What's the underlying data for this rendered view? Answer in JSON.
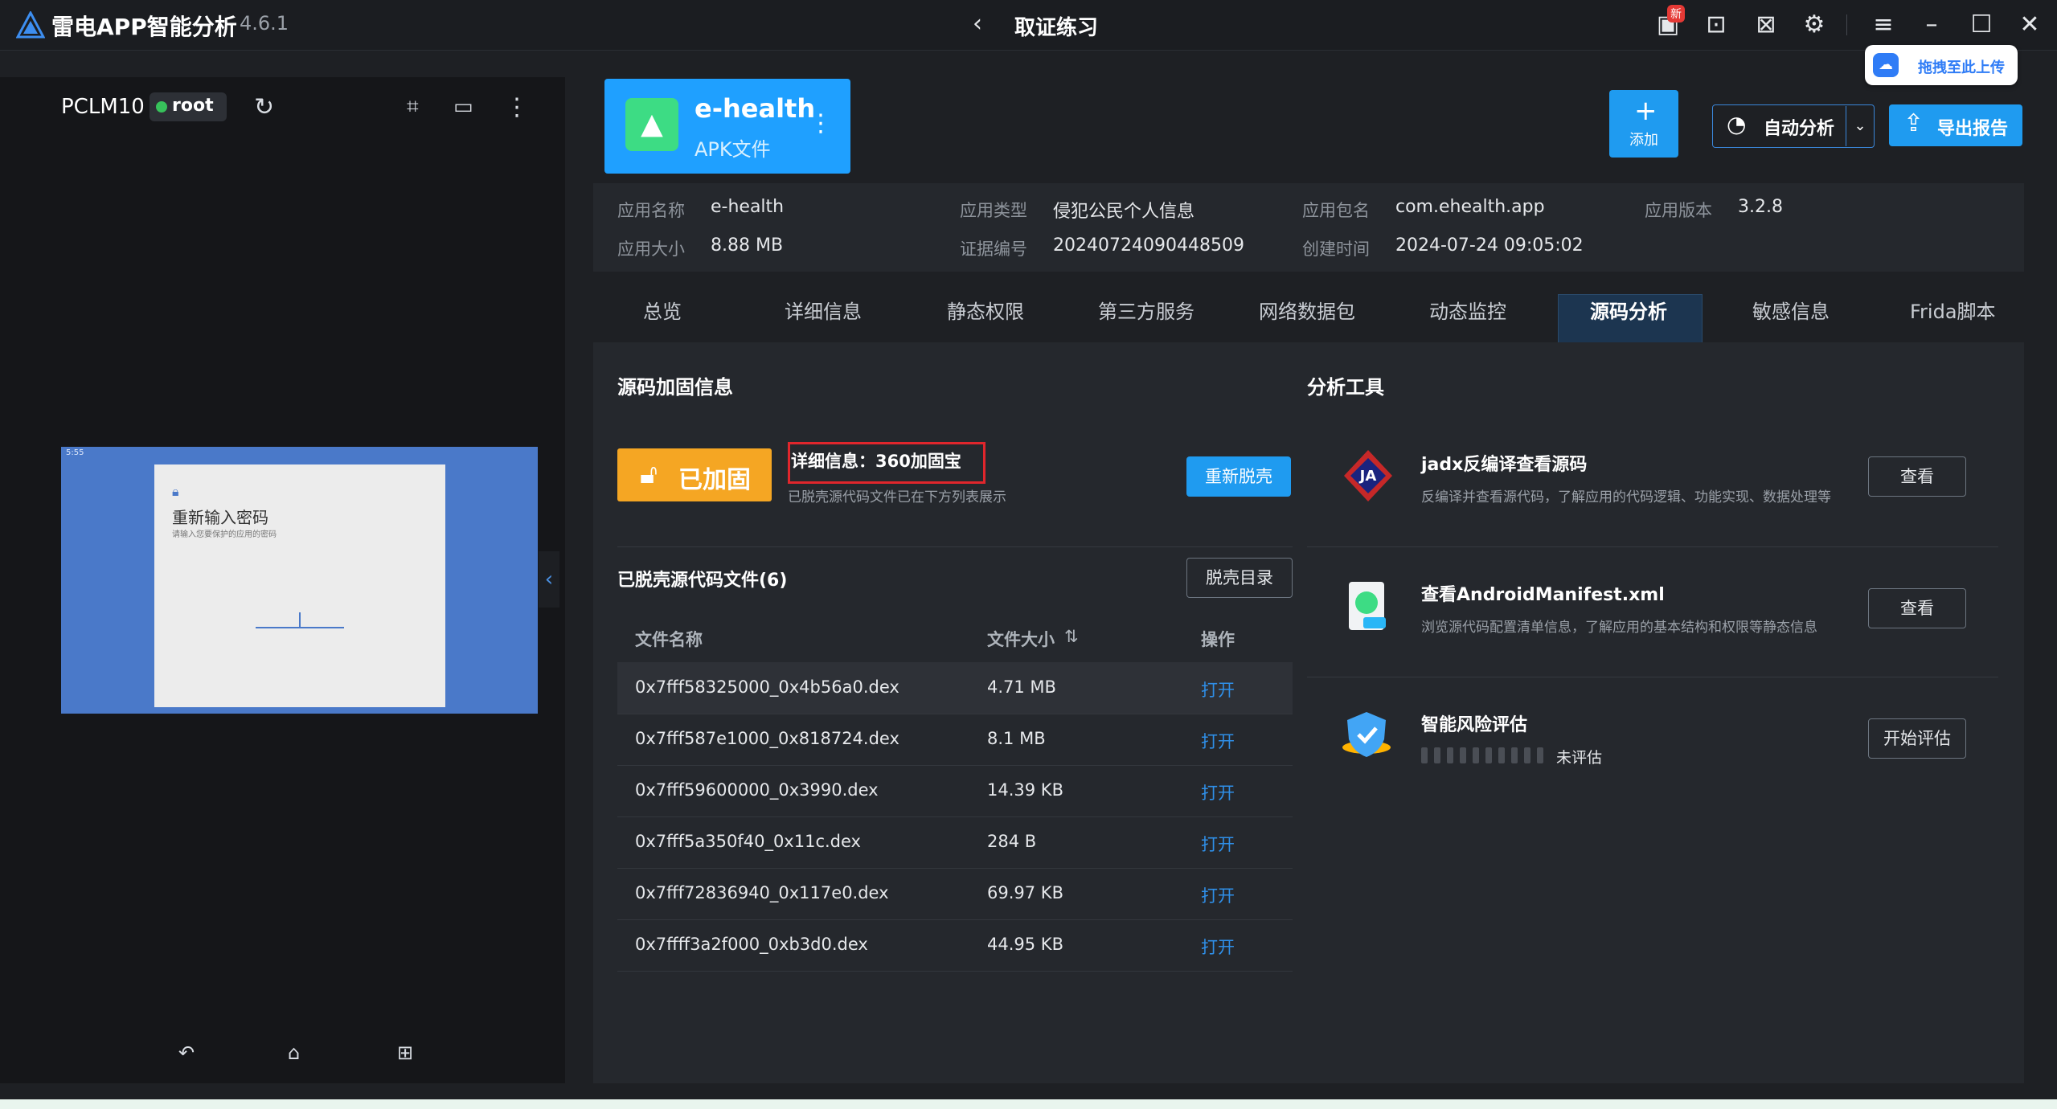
{
  "app": {
    "title": "雷电APP智能分析",
    "version": "4.6.1"
  },
  "header": {
    "page_title": "取证练习",
    "new_badge": "新",
    "upload_label": "拖拽至此上传"
  },
  "device": {
    "name": "PCLM10",
    "root_label": "root"
  },
  "screen": {
    "dialog_title": "重新输入密码",
    "dialog_sub": "请输入您要保护的应用的密码",
    "status_left": "5:55"
  },
  "app_card": {
    "name": "e-health",
    "type": "APK文件"
  },
  "toolbar": {
    "add_label": "添加",
    "auto_label": "自动分析",
    "export_label": "导出报告"
  },
  "app_info": [
    {
      "label": "应用名称",
      "value": "e-health"
    },
    {
      "label": "应用类型",
      "value": "侵犯公民个人信息"
    },
    {
      "label": "应用包名",
      "value": "com.ehealth.app"
    },
    {
      "label": "应用版本",
      "value": "3.2.8"
    },
    {
      "label": "应用大小",
      "value": "8.88 MB"
    },
    {
      "label": "证据编号",
      "value": "20240724090448509"
    },
    {
      "label": "创建时间",
      "value": "2024-07-24 09:05:02"
    }
  ],
  "tabs": [
    "总览",
    "详细信息",
    "静态权限",
    "第三方服务",
    "网络数据包",
    "动态监控",
    "源码分析",
    "敏感信息",
    "Frida脚本"
  ],
  "active_tab": "源码分析",
  "harden": {
    "section_title": "源码加固信息",
    "status_label": "已加固",
    "detail": "详细信息：360加固宝",
    "detail_sub": "已脱壳源代码文件已在下方列表展示",
    "reshell_label": "重新脱壳"
  },
  "files": {
    "title": "已脱壳源代码文件(6)",
    "dir_label": "脱壳目录",
    "columns": [
      "文件名称",
      "文件大小",
      "操作"
    ],
    "rows": [
      {
        "name": "0x7fff58325000_0x4b56a0.dex",
        "size": "4.71 MB",
        "action": "打开"
      },
      {
        "name": "0x7fff587e1000_0x818724.dex",
        "size": "8.1 MB",
        "action": "打开"
      },
      {
        "name": "0x7fff59600000_0x3990.dex",
        "size": "14.39 KB",
        "action": "打开"
      },
      {
        "name": "0x7fff5a350f40_0x11c.dex",
        "size": "284 B",
        "action": "打开"
      },
      {
        "name": "0x7fff72836940_0x117e0.dex",
        "size": "69.97 KB",
        "action": "打开"
      },
      {
        "name": "0x7ffff3a2f000_0xb3d0.dex",
        "size": "44.95 KB",
        "action": "打开"
      }
    ]
  },
  "tools": {
    "section_title": "分析工具",
    "items": [
      {
        "name": "jadx反编译查看源码",
        "desc": "反编译并查看源代码，了解应用的代码逻辑、功能实现、数据处理等",
        "button": "查看",
        "icon": "jadx-icon"
      },
      {
        "name": "查看AndroidManifest.xml",
        "desc": "浏览源代码配置清单信息，了解应用的基本结构和权限等静态信息",
        "button": "查看",
        "icon": "manifest-icon"
      },
      {
        "name": "智能风险评估",
        "desc": "未评估",
        "button": "开始评估",
        "icon": "risk-shield-icon"
      }
    ]
  },
  "colors": {
    "accent": "#1f9bf0",
    "warning": "#f5a623",
    "highlight_border": "#e0262c",
    "link": "#2f8fe8"
  }
}
